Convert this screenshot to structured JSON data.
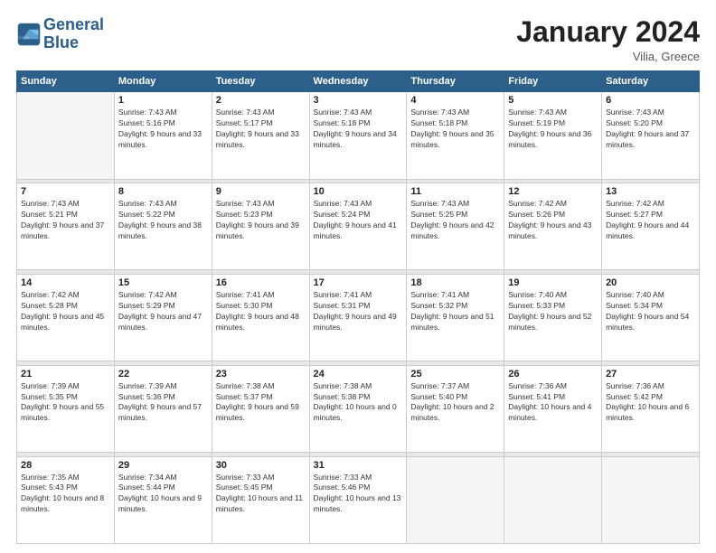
{
  "header": {
    "logo_line1": "General",
    "logo_line2": "Blue",
    "month_year": "January 2024",
    "location": "Vilia, Greece"
  },
  "weekdays": [
    "Sunday",
    "Monday",
    "Tuesday",
    "Wednesday",
    "Thursday",
    "Friday",
    "Saturday"
  ],
  "weeks": [
    [
      {
        "day": "",
        "empty": true
      },
      {
        "day": "1",
        "sunrise": "7:43 AM",
        "sunset": "5:16 PM",
        "daylight": "9 hours and 33 minutes."
      },
      {
        "day": "2",
        "sunrise": "7:43 AM",
        "sunset": "5:17 PM",
        "daylight": "9 hours and 33 minutes."
      },
      {
        "day": "3",
        "sunrise": "7:43 AM",
        "sunset": "5:18 PM",
        "daylight": "9 hours and 34 minutes."
      },
      {
        "day": "4",
        "sunrise": "7:43 AM",
        "sunset": "5:18 PM",
        "daylight": "9 hours and 35 minutes."
      },
      {
        "day": "5",
        "sunrise": "7:43 AM",
        "sunset": "5:19 PM",
        "daylight": "9 hours and 36 minutes."
      },
      {
        "day": "6",
        "sunrise": "7:43 AM",
        "sunset": "5:20 PM",
        "daylight": "9 hours and 37 minutes."
      }
    ],
    [
      {
        "day": "7",
        "sunrise": "7:43 AM",
        "sunset": "5:21 PM",
        "daylight": "9 hours and 37 minutes."
      },
      {
        "day": "8",
        "sunrise": "7:43 AM",
        "sunset": "5:22 PM",
        "daylight": "9 hours and 38 minutes."
      },
      {
        "day": "9",
        "sunrise": "7:43 AM",
        "sunset": "5:23 PM",
        "daylight": "9 hours and 39 minutes."
      },
      {
        "day": "10",
        "sunrise": "7:43 AM",
        "sunset": "5:24 PM",
        "daylight": "9 hours and 41 minutes."
      },
      {
        "day": "11",
        "sunrise": "7:43 AM",
        "sunset": "5:25 PM",
        "daylight": "9 hours and 42 minutes."
      },
      {
        "day": "12",
        "sunrise": "7:42 AM",
        "sunset": "5:26 PM",
        "daylight": "9 hours and 43 minutes."
      },
      {
        "day": "13",
        "sunrise": "7:42 AM",
        "sunset": "5:27 PM",
        "daylight": "9 hours and 44 minutes."
      }
    ],
    [
      {
        "day": "14",
        "sunrise": "7:42 AM",
        "sunset": "5:28 PM",
        "daylight": "9 hours and 45 minutes."
      },
      {
        "day": "15",
        "sunrise": "7:42 AM",
        "sunset": "5:29 PM",
        "daylight": "9 hours and 47 minutes."
      },
      {
        "day": "16",
        "sunrise": "7:41 AM",
        "sunset": "5:30 PM",
        "daylight": "9 hours and 48 minutes."
      },
      {
        "day": "17",
        "sunrise": "7:41 AM",
        "sunset": "5:31 PM",
        "daylight": "9 hours and 49 minutes."
      },
      {
        "day": "18",
        "sunrise": "7:41 AM",
        "sunset": "5:32 PM",
        "daylight": "9 hours and 51 minutes."
      },
      {
        "day": "19",
        "sunrise": "7:40 AM",
        "sunset": "5:33 PM",
        "daylight": "9 hours and 52 minutes."
      },
      {
        "day": "20",
        "sunrise": "7:40 AM",
        "sunset": "5:34 PM",
        "daylight": "9 hours and 54 minutes."
      }
    ],
    [
      {
        "day": "21",
        "sunrise": "7:39 AM",
        "sunset": "5:35 PM",
        "daylight": "9 hours and 55 minutes."
      },
      {
        "day": "22",
        "sunrise": "7:39 AM",
        "sunset": "5:36 PM",
        "daylight": "9 hours and 57 minutes."
      },
      {
        "day": "23",
        "sunrise": "7:38 AM",
        "sunset": "5:37 PM",
        "daylight": "9 hours and 59 minutes."
      },
      {
        "day": "24",
        "sunrise": "7:38 AM",
        "sunset": "5:38 PM",
        "daylight": "10 hours and 0 minutes."
      },
      {
        "day": "25",
        "sunrise": "7:37 AM",
        "sunset": "5:40 PM",
        "daylight": "10 hours and 2 minutes."
      },
      {
        "day": "26",
        "sunrise": "7:36 AM",
        "sunset": "5:41 PM",
        "daylight": "10 hours and 4 minutes."
      },
      {
        "day": "27",
        "sunrise": "7:36 AM",
        "sunset": "5:42 PM",
        "daylight": "10 hours and 6 minutes."
      }
    ],
    [
      {
        "day": "28",
        "sunrise": "7:35 AM",
        "sunset": "5:43 PM",
        "daylight": "10 hours and 8 minutes."
      },
      {
        "day": "29",
        "sunrise": "7:34 AM",
        "sunset": "5:44 PM",
        "daylight": "10 hours and 9 minutes."
      },
      {
        "day": "30",
        "sunrise": "7:33 AM",
        "sunset": "5:45 PM",
        "daylight": "10 hours and 11 minutes."
      },
      {
        "day": "31",
        "sunrise": "7:33 AM",
        "sunset": "5:46 PM",
        "daylight": "10 hours and 13 minutes."
      },
      {
        "day": "",
        "empty": true
      },
      {
        "day": "",
        "empty": true
      },
      {
        "day": "",
        "empty": true
      }
    ]
  ],
  "labels": {
    "sunrise": "Sunrise:",
    "sunset": "Sunset:",
    "daylight": "Daylight:"
  }
}
